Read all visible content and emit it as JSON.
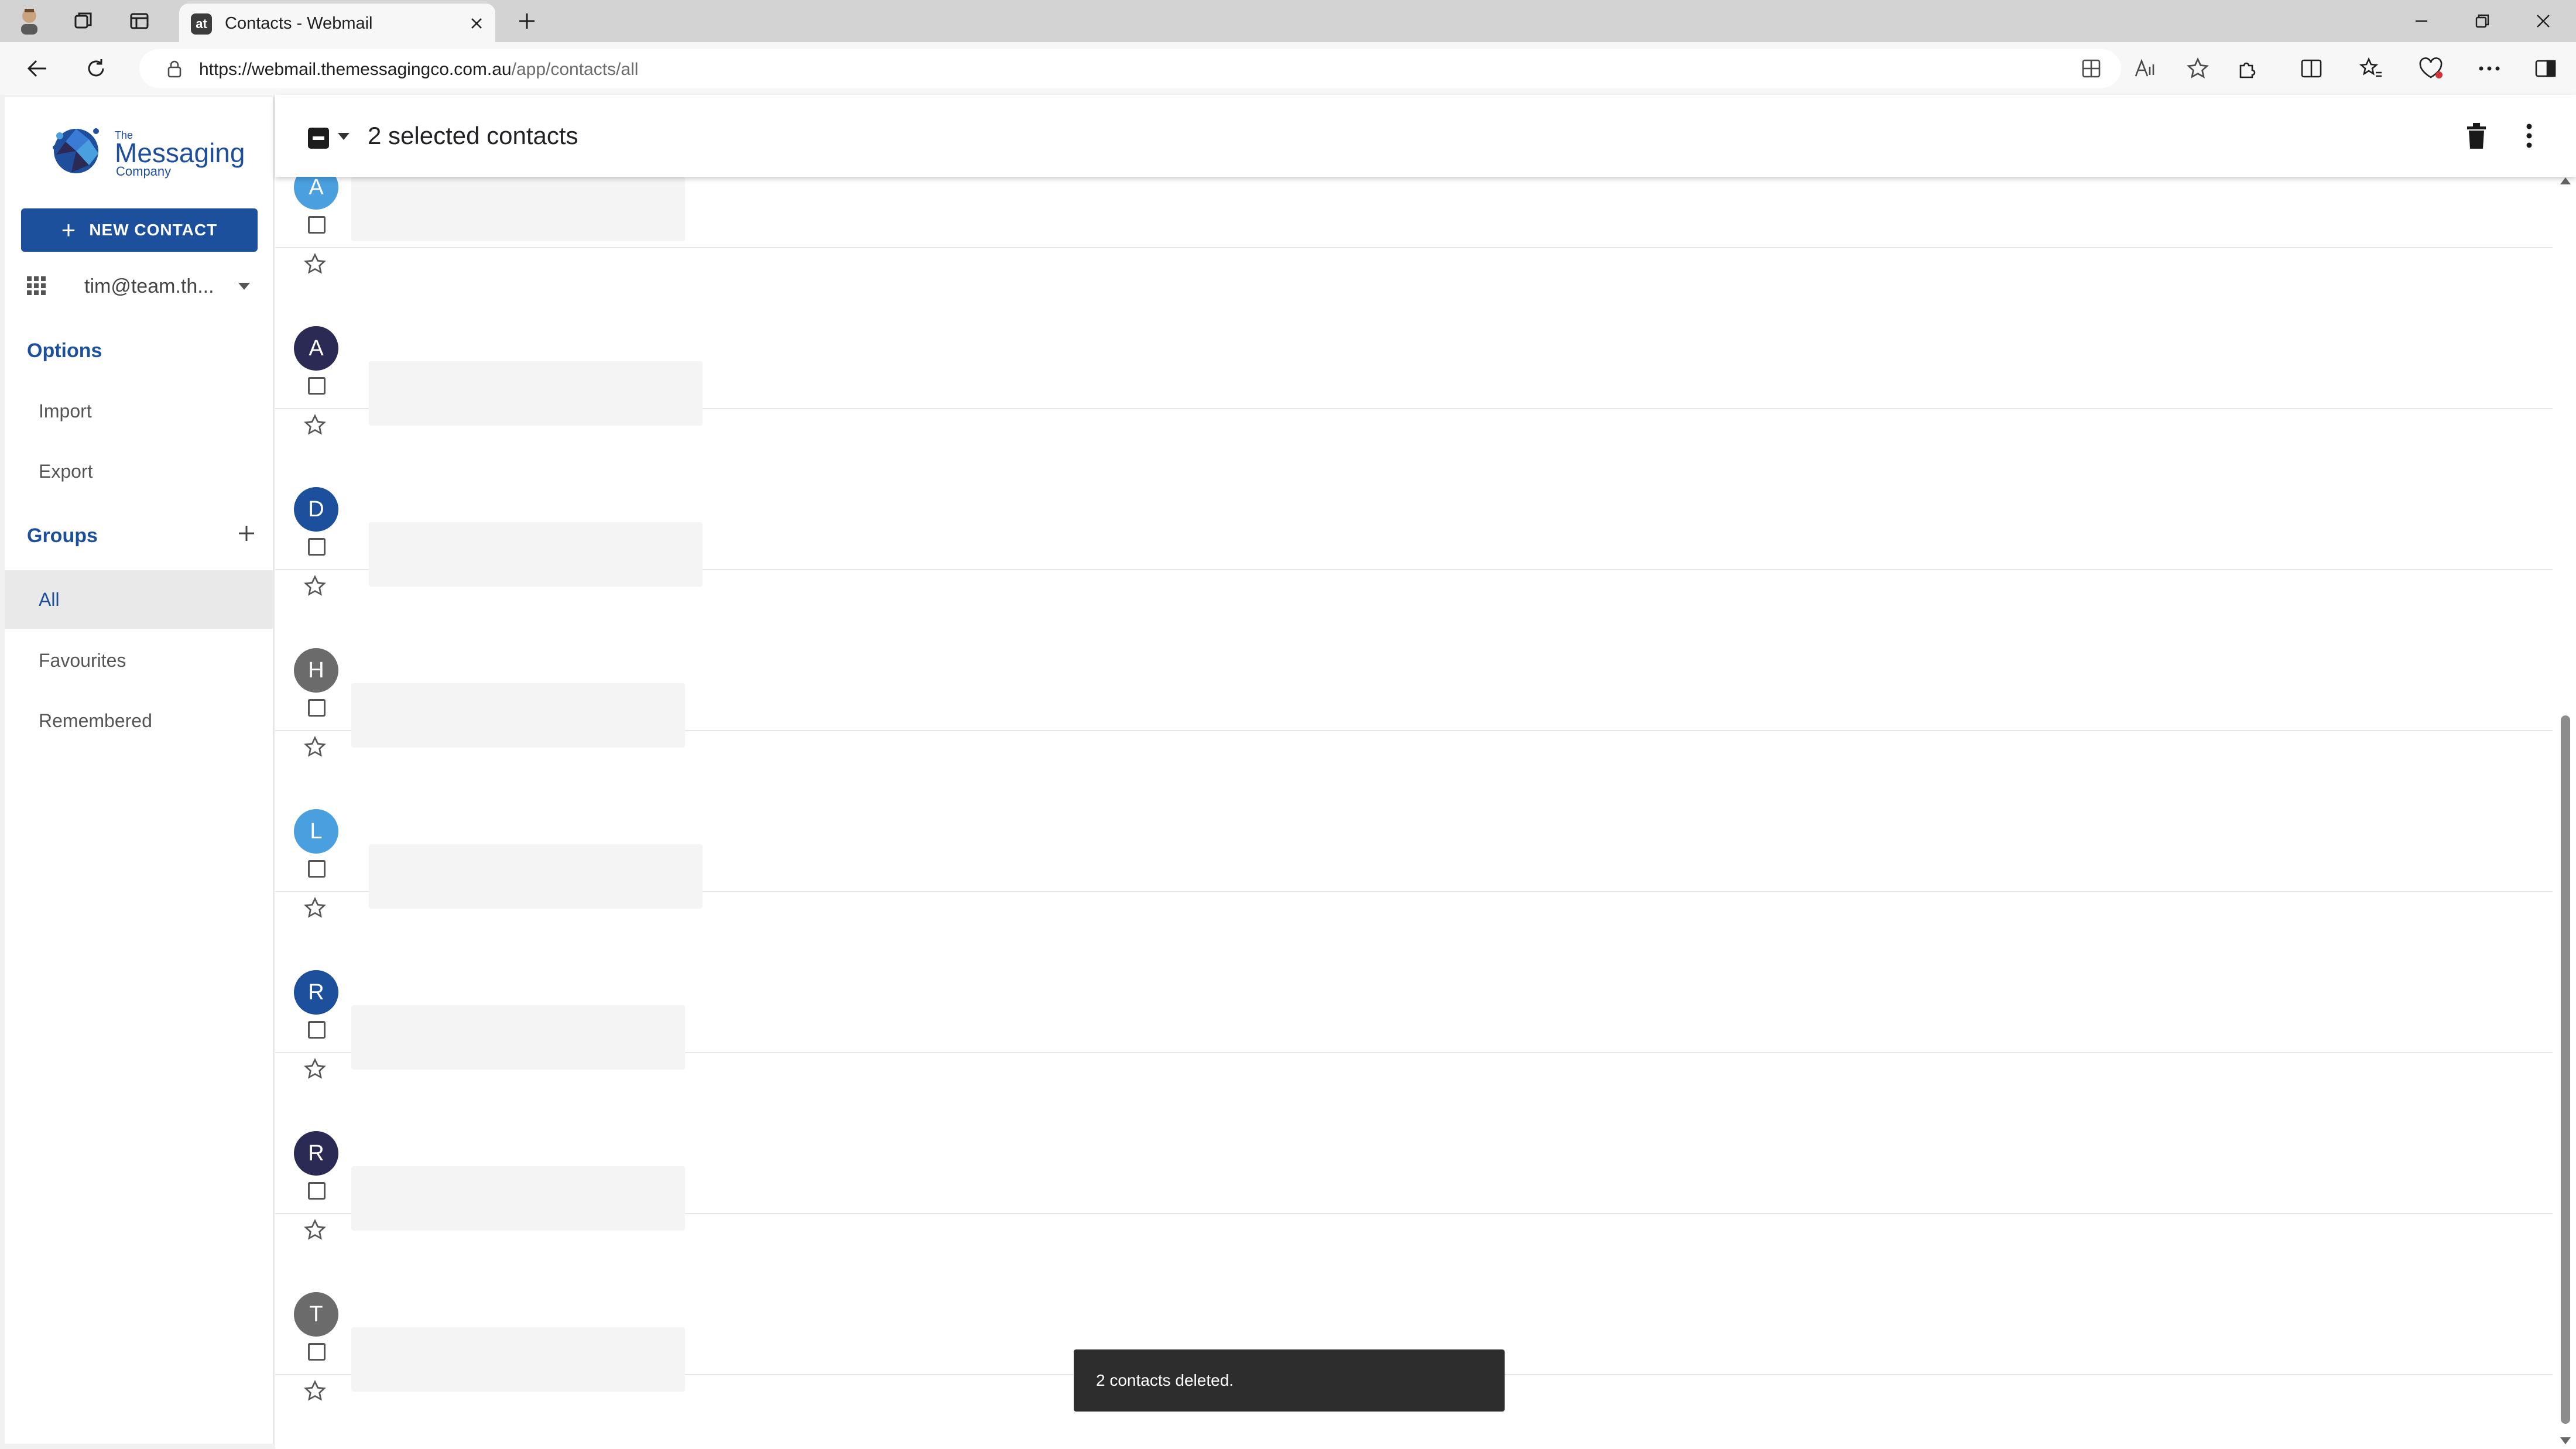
{
  "browser": {
    "tab_title": "Contacts - Webmail",
    "tab_favicon": "at",
    "url_host": "https://webmail.themessagingco.com.au",
    "url_path": "/app/contacts/all"
  },
  "sidebar": {
    "logo": {
      "line1": "The",
      "line2": "Messaging",
      "line3": "Company"
    },
    "new_contact_label": "NEW CONTACT",
    "account_email": "tim@team.th...",
    "options_heading": "Options",
    "options_items": [
      "Import",
      "Export"
    ],
    "groups_heading": "Groups",
    "group_items": [
      "All",
      "Favourites",
      "Remembered"
    ],
    "active_group": "All"
  },
  "toolbar": {
    "selection_text": "2 selected contacts"
  },
  "contacts": [
    {
      "initial": "A",
      "color": "#4a9fde"
    },
    {
      "initial": "A",
      "color": "#2a2a55"
    },
    {
      "initial": "D",
      "color": "#1c4f9c"
    },
    {
      "initial": "H",
      "color": "#6b6b6b"
    },
    {
      "initial": "L",
      "color": "#4a9fde"
    },
    {
      "initial": "R",
      "color": "#1c4f9c"
    },
    {
      "initial": "R",
      "color": "#2a2a55"
    },
    {
      "initial": "T",
      "color": "#6b6b6b"
    }
  ],
  "toast": {
    "message": "2 contacts deleted."
  },
  "colors": {
    "accent": "#1c4f9c"
  }
}
